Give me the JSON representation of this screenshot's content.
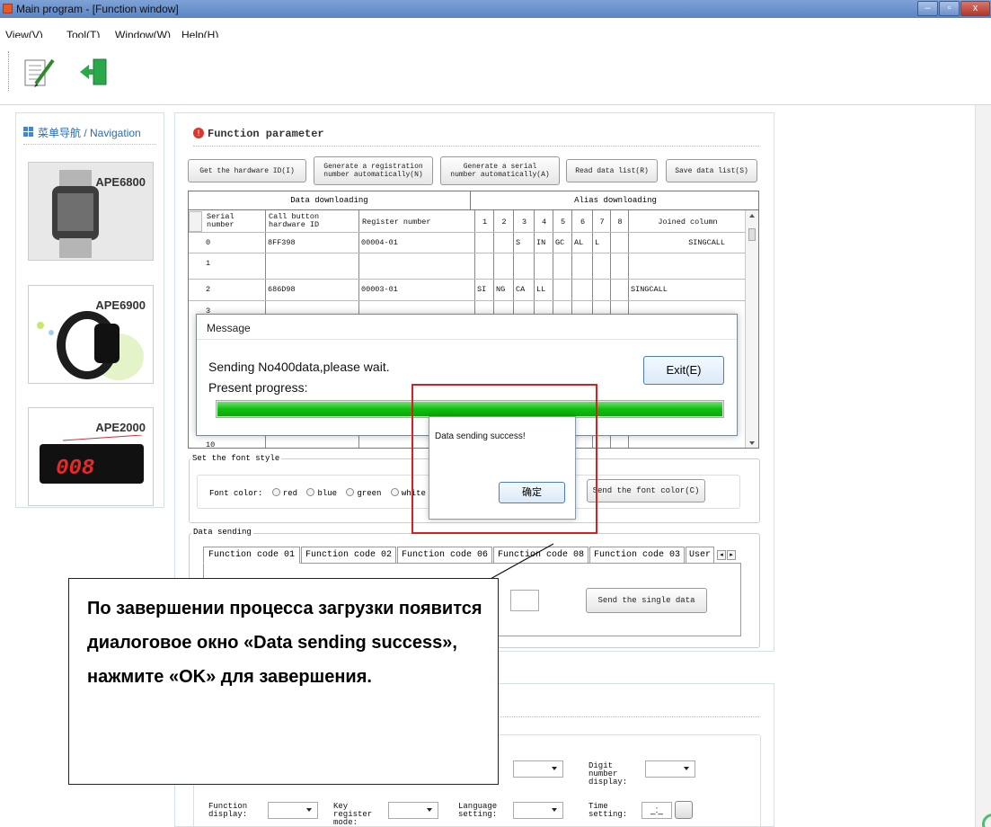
{
  "window": {
    "title": "Main program - [Function window]",
    "controls": {
      "minimize": "–",
      "maximize": "▫",
      "close": "x"
    }
  },
  "menu": [
    "View(V)",
    "Tool(T)",
    "Window(W)",
    "Help(H)"
  ],
  "toolbar": {
    "icons": [
      "edit-document-icon",
      "exit-door-icon"
    ]
  },
  "navigation": {
    "title": "菜单导航 / Navigation",
    "items": [
      {
        "label": "APE6800",
        "screen": "00001\n99"
      },
      {
        "label": "APE6900"
      },
      {
        "label": "APE2000",
        "display": "008"
      }
    ]
  },
  "function_panel": {
    "title": "Function parameter",
    "buttons": {
      "get_hardware_id": "Get the hardware ID(I)",
      "gen_registration": "Generate a registration number automatically(N)",
      "gen_serial": "Generate a serial number automatically(A)",
      "read_data": "Read data list(R)",
      "save_data": "Save data list(S)"
    },
    "grid": {
      "group_headers": [
        "Data downloading",
        "Alias downloading"
      ],
      "columns": [
        "Serial number",
        "Call button hardware ID",
        "Register number",
        "1",
        "2",
        "3",
        "4",
        "5",
        "6",
        "7",
        "8",
        "Joined column"
      ],
      "rows": [
        [
          "0",
          "8FF398",
          "00004-01",
          "",
          "",
          "S",
          "IN",
          "GC",
          "AL",
          "L",
          "",
          "SINGCALL"
        ],
        [
          "1",
          "",
          "",
          "",
          "",
          "",
          "",
          "",
          "",
          "",
          "",
          ""
        ],
        [
          "2",
          "686D98",
          "00003-01",
          "SI",
          "NG",
          "CA",
          "LL",
          "",
          "",
          "",
          "",
          "SINGCALL"
        ],
        [
          "3",
          "",
          "",
          "",
          "",
          "",
          "",
          "",
          "",
          "",
          "",
          ""
        ]
      ],
      "last_row": "10"
    },
    "font_style": {
      "legend": "Set the font style",
      "label": "Font color:",
      "options": [
        "red",
        "blue",
        "green",
        "white"
      ],
      "send_button": "Send the font color(C)"
    },
    "data_sending": {
      "legend": "Data sending",
      "tabs": [
        "Function code 01",
        "Function code 02",
        "Function code 06",
        "Function code 08",
        "Function code 03",
        "User"
      ],
      "send_single": "Send the single data"
    }
  },
  "message_box": {
    "title": "Message",
    "status": "Sending No400data,please wait.",
    "progress_label": "Present progress:",
    "exit_button": "Exit(E)",
    "progress": 1.0
  },
  "success_dialog": {
    "text": "Data sending success!",
    "ok_button": "确定"
  },
  "callout": {
    "text": "По завершении процесса загрузки появится диалоговое окно «Data sending success», нажмите «OK» для завершения."
  },
  "lower_panel": {
    "digit_number_display": "Digit number display:",
    "function_display": "Function display:",
    "key_register_mode": "Key register mode:",
    "language_setting": "Language setting:",
    "time_setting": "Time setting:",
    "time_value": "_:_"
  },
  "colors": {
    "progress": "#0fbf0f",
    "highlight": "#d8201f",
    "nav_title": "#2a6cb5"
  }
}
